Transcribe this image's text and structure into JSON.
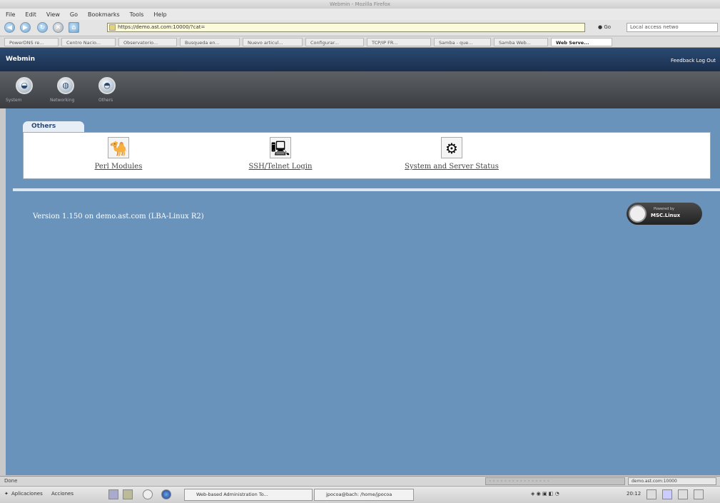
{
  "window": {
    "title": "Webmin - Mozilla Firefox"
  },
  "menu": [
    "File",
    "Edit",
    "View",
    "Go",
    "Bookmarks",
    "Tools",
    "Help"
  ],
  "nav": {
    "url": "https://demo.ast.com:10000/?cat=",
    "go_label": "Go",
    "search_placeholder": "Local access netwo"
  },
  "bookmark_tabs": [
    {
      "label": "PowerDNS re..."
    },
    {
      "label": "Centro Nacio..."
    },
    {
      "label": "Observatorio..."
    },
    {
      "label": "Busqueda en..."
    },
    {
      "label": "Nuevo articul..."
    },
    {
      "label": "Configurar..."
    },
    {
      "label": "TCP/IP FR..."
    },
    {
      "label": "Samba - que..."
    },
    {
      "label": "Samba Web..."
    },
    {
      "label": "Web Serve...",
      "active": true
    }
  ],
  "header": {
    "logo": "Webmin",
    "links": "Feedback   Log Out"
  },
  "categories": [
    {
      "icon": "system-icon",
      "label": "System"
    },
    {
      "icon": "networking-icon",
      "label": "Networking"
    },
    {
      "icon": "others-icon",
      "label": "Others"
    }
  ],
  "section": {
    "tab_label": "Others",
    "modules": [
      {
        "label": "Perl Modules",
        "icon": "camel-icon"
      },
      {
        "label": "SSH/Telnet Login",
        "icon": "terminal-icon"
      },
      {
        "label": "System and Server Status",
        "icon": "status-icon"
      }
    ]
  },
  "footer": {
    "version": "Version 1.150 on demo.ast.com (LBA-Linux R2)",
    "badge_small": "Powered by",
    "badge_main": "MSC.Linux"
  },
  "statusbar": {
    "text": "Done",
    "right": "demo.ast.com:10000"
  },
  "taskbar": {
    "apps": "Aplicaciones",
    "actions": "Acciones",
    "window1": "Web-based Administration To...",
    "window2": "jpocoa@bach: /home/jpocoa",
    "clock": "20:12"
  },
  "colors": {
    "main_bg": "#6a93bb",
    "header_dark": "#1b2f4e",
    "panel_bg": "#ffffff"
  }
}
